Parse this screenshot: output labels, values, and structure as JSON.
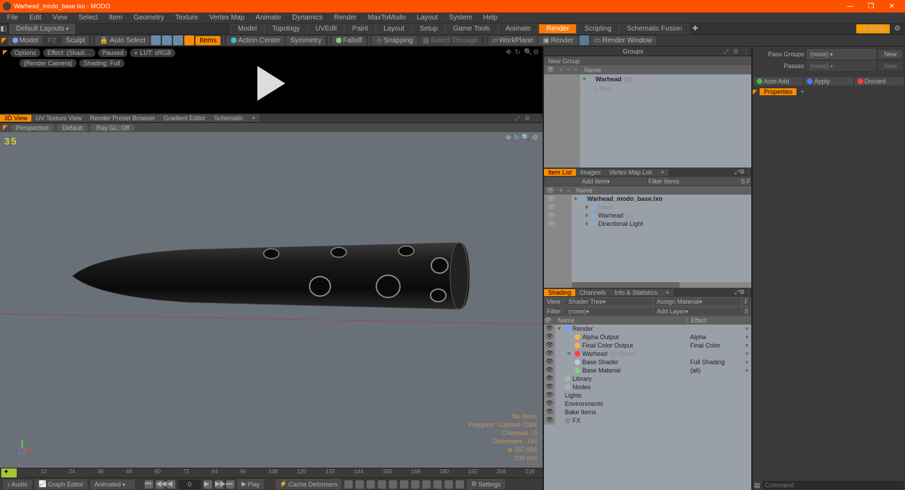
{
  "app": {
    "title": "Warhead_modo_base.lxo - MODO"
  },
  "window": {
    "minimize": "—",
    "maximize": "❐",
    "close": "✕"
  },
  "menu": [
    "File",
    "Edit",
    "View",
    "Select",
    "Item",
    "Geometry",
    "Texture",
    "Vertex Map",
    "Animate",
    "Dynamics",
    "Render",
    "MaxToModo",
    "Layout",
    "System",
    "Help"
  ],
  "layouts": {
    "dropdown": "Default Layouts",
    "tabs": [
      "Model",
      "Topology",
      "UVEdit",
      "Paint",
      "Layout",
      "Setup",
      "Game Tools",
      "Animate",
      "Render",
      "Scripting",
      "Schematic Fusion"
    ],
    "active": 8,
    "only": "Only"
  },
  "toolshelf": {
    "model": "Model",
    "sculpt": "Sculpt",
    "autoSelect": "Auto Select",
    "items": "Items",
    "actionCenter": "Action Center",
    "symmetry": "Symmetry",
    "falloff": "Falloff",
    "snapping": "Snapping",
    "selectThrough": "Select Through",
    "workplane": "WorkPlane",
    "render": "Render",
    "renderWindow": "Render Window"
  },
  "preview": {
    "options": "Options",
    "effect": "Effect: (Shadi…",
    "paused": "Paused",
    "lut": "LUT: sRGB",
    "renderCamera": "(Render Camera)",
    "shading": "Shading: Full"
  },
  "vptabs": {
    "tabs": [
      "3D View",
      "UV Texture View",
      "Render Preset Browser",
      "Gradient Editor",
      "Schematic"
    ],
    "plus": "+"
  },
  "viewport": {
    "perspective": "Perspective",
    "default": "Default",
    "raygl": "Ray GL: Off",
    "fps": "35",
    "overlay": {
      "noitems": "No Items",
      "polygons": "Polygons : Catmull-Clark",
      "channels": "Channels : 0",
      "deformers": "Deformers : ON",
      "verts": "357,056",
      "scale": "100 mm"
    }
  },
  "timeline": {
    "ticks": [
      "12",
      "24",
      "36",
      "48",
      "60",
      "72",
      "84",
      "96",
      "108",
      "120",
      "132",
      "144",
      "156",
      "168",
      "180",
      "192",
      "204",
      "216"
    ]
  },
  "transport": {
    "audio": "Audio",
    "graph": "Graph Editor",
    "mode": "Animated",
    "frame": "0",
    "play": "Play",
    "cache": "Cache Deformers",
    "settings": "Settings"
  },
  "groups": {
    "title": "Groups",
    "newGroup": "New Group",
    "nameCol": "Name",
    "item": {
      "name": "Warhead",
      "count": "(3)",
      "kind": "Group",
      "sub": "1 Item"
    }
  },
  "itemlist": {
    "tabs": [
      "Item List",
      "Images",
      "Vertex Map List"
    ],
    "plus": "+",
    "addItem": "Add Item",
    "filterItems": "Filter Items",
    "nameCol": "Name",
    "rows": [
      {
        "name": "Warhead_modo_base.lxo",
        "bold": true,
        "indent": 0,
        "icon": "scene"
      },
      {
        "name": "Mesh",
        "indent": 1,
        "icon": "mesh",
        "dim": true
      },
      {
        "name": "Warhead",
        "suffix": "(7)",
        "indent": 1,
        "icon": "cam"
      },
      {
        "name": "Directional Light",
        "indent": 1,
        "icon": "light"
      }
    ]
  },
  "shading": {
    "tabs": [
      "Shading",
      "Channels",
      "Info & Statistics"
    ],
    "plus": "+",
    "view": "View",
    "shaderTree": "Shader Tree",
    "assignMaterial": "Assign Material",
    "filter": "Filter",
    "none": "(none)",
    "addLayer": "Add Layer",
    "nameCol": "Name",
    "effectCol": "Effect",
    "rows": [
      {
        "name": "Render",
        "effect": "",
        "indent": 0,
        "icon": "#6aa6ff",
        "expand": true
      },
      {
        "name": "Alpha Output",
        "effect": "Alpha",
        "indent": 1,
        "icon": "#ffb050"
      },
      {
        "name": "Final Color Output",
        "effect": "Final Color",
        "indent": 1,
        "icon": "#ffb050"
      },
      {
        "name": "Warhead",
        "suffix": "(2) (Item)",
        "effect": "",
        "indent": 1,
        "icon": "#ff4040",
        "expand": true
      },
      {
        "name": "Base Shader",
        "effect": "Full Shading",
        "indent": 1,
        "icon": "#c8c8c8"
      },
      {
        "name": "Base Material",
        "effect": "(all)",
        "indent": 1,
        "icon": "#80d080"
      },
      {
        "name": "Library",
        "indent": 0,
        "icon": "#b0b0b0"
      },
      {
        "name": "Nodes",
        "indent": 0,
        "icon": "#b0b0b0"
      },
      {
        "name": "Lights",
        "indent": 0
      },
      {
        "name": "Environments",
        "indent": 0
      },
      {
        "name": "Bake Items",
        "indent": 0
      },
      {
        "name": "FX",
        "indent": 0,
        "icon": "#888"
      }
    ]
  },
  "right2": {
    "passGroups": "Pass Groups",
    "passes": "Passes",
    "none": "(none)",
    "new": "New",
    "autoAdd": "Auto Add",
    "apply": "Apply",
    "discard": "Discard",
    "properties": "Properties",
    "plus": "+",
    "command": "Command"
  }
}
